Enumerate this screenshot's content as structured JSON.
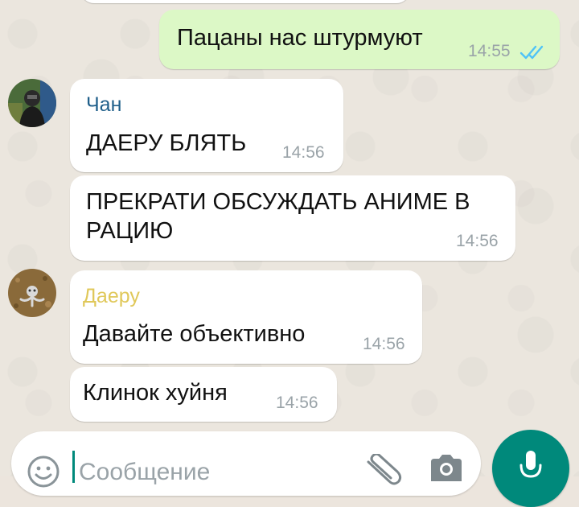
{
  "chat": {
    "messages": [
      {
        "sender": "",
        "text": "Пацаны нас штурмуют",
        "time": "14:55"
      },
      {
        "sender": "Чан",
        "text": "ДАЕРУ БЛЯТЬ",
        "time": "14:56"
      },
      {
        "sender": "",
        "text_line1": "ПРЕКРАТИ ОБСУЖДАТЬ АНИМЕ В",
        "text_line2": "РАЦИЮ",
        "time": "14:56"
      },
      {
        "sender": "Даеру",
        "text": "Давайте объективно",
        "time": "14:56"
      },
      {
        "sender": "",
        "text": "Клинок хуйня",
        "time": "14:56"
      }
    ]
  },
  "input": {
    "placeholder": "Сообщение"
  },
  "colors": {
    "outgoing_bubble": "#dcf8c6",
    "incoming_bubble": "#ffffff",
    "read_ticks": "#4fc3f7",
    "sender_chan": "#1f5f8a",
    "sender_daeru": "#e0c85a",
    "mic_button": "#00897b"
  },
  "icons": [
    "double-check-icon",
    "emoji-icon",
    "attach-icon",
    "camera-icon",
    "mic-icon"
  ]
}
